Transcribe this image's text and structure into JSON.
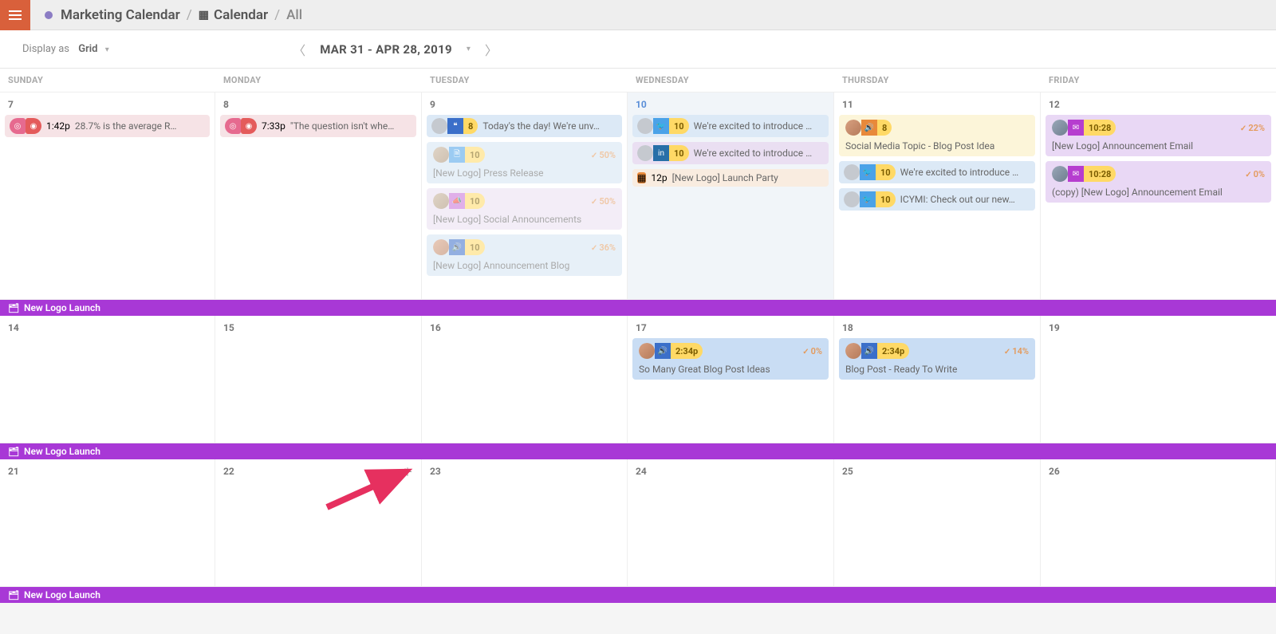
{
  "header": {
    "breadcrumb_root": "Marketing Calendar",
    "breadcrumb_view": "Calendar",
    "breadcrumb_filter": "All"
  },
  "toolbar": {
    "display_label": "Display as",
    "display_value": "Grid",
    "date_range": "MAR 31 - APR 28, 2019"
  },
  "day_headers": [
    "SUNDAY",
    "MONDAY",
    "TUESDAY",
    "WEDNESDAY",
    "THURSDAY",
    "FRIDAY"
  ],
  "campaign_label": "New Logo Launch",
  "weeks": [
    {
      "days": [
        {
          "num": "7",
          "events": [
            {
              "type": "strip",
              "bg": "bg-pink-l faded",
              "icons": [
                {
                  "cls": "ic-pink",
                  "glyph": "◎"
                },
                {
                  "cls": "ic-red",
                  "glyph": "◉"
                }
              ],
              "time": "1:42p",
              "text": "28.7% is the average R…"
            }
          ]
        },
        {
          "num": "8",
          "events": [
            {
              "type": "strip",
              "bg": "bg-pink-l faded",
              "icons": [
                {
                  "cls": "ic-pink",
                  "glyph": "◎"
                },
                {
                  "cls": "ic-red",
                  "glyph": "◉"
                }
              ],
              "time": "7:33p",
              "text": "\"The question isn't whe…"
            }
          ]
        },
        {
          "num": "9",
          "events": [
            {
              "type": "strip",
              "bg": "bg-blue-l faded",
              "avatar": "generic",
              "icons": [
                {
                  "cls": "ic-blue",
                  "glyph": "❝"
                }
              ],
              "badge": "8",
              "text": "Today's the day! We're unv…"
            },
            {
              "type": "card",
              "bg": "bg-blue-l2 faded",
              "avatar": "a1",
              "icons": [
                {
                  "cls": "ic-doc",
                  "glyph": "🗎"
                }
              ],
              "badge": "10",
              "progress": "50%",
              "title": "[New Logo] Press Release"
            },
            {
              "type": "card",
              "bg": "bg-purple-l faded",
              "avatar": "a1",
              "icons": [
                {
                  "cls": "ic-horn",
                  "glyph": "📣"
                }
              ],
              "badge": "10",
              "progress": "50%",
              "title": "[New Logo] Social Announcements"
            },
            {
              "type": "card",
              "bg": "bg-blue-l2 faded",
              "avatar": "a2",
              "icons": [
                {
                  "cls": "ic-rss",
                  "glyph": "🔊"
                }
              ],
              "badge": "10",
              "progress": "36%",
              "title": "[New Logo] Announcement Blog"
            }
          ]
        },
        {
          "num": "10",
          "today": true,
          "events": [
            {
              "type": "strip",
              "bg": "bg-blue-l",
              "avatar": "generic",
              "icons": [
                {
                  "cls": "ic-twitter",
                  "glyph": "🐦"
                }
              ],
              "badge": "10",
              "text": "We're excited to introduce …"
            },
            {
              "type": "strip",
              "bg": "bg-purple-l",
              "avatar": "generic",
              "icons": [
                {
                  "cls": "ic-linkedin",
                  "glyph": "in"
                }
              ],
              "badge": "10",
              "text": "We're excited to introduce …"
            },
            {
              "type": "strip",
              "bg": "bg-orange-l",
              "icons": [
                {
                  "cls": "ic-cal",
                  "glyph": "▦"
                }
              ],
              "time": "12p",
              "text": "[New Logo] Launch Party"
            }
          ]
        },
        {
          "num": "11",
          "events": [
            {
              "type": "card",
              "bg": "bg-yellow-l",
              "avatar": "a2",
              "icons": [
                {
                  "cls": "ic-rss-o",
                  "glyph": "🔊"
                }
              ],
              "badge": "8",
              "title": "Social Media Topic - Blog Post Idea"
            },
            {
              "type": "strip",
              "bg": "bg-blue-l",
              "avatar": "generic",
              "icons": [
                {
                  "cls": "ic-twitter",
                  "glyph": "🐦"
                }
              ],
              "badge": "10",
              "text": "We're excited to introduce …"
            },
            {
              "type": "strip",
              "bg": "bg-blue-l",
              "avatar": "generic",
              "icons": [
                {
                  "cls": "ic-twitter",
                  "glyph": "🐦"
                }
              ],
              "badge": "10",
              "text": "ICYMI: Check out our new…"
            }
          ]
        },
        {
          "num": "12",
          "events": [
            {
              "type": "card",
              "bg": "bg-purple2",
              "avatar": "a3",
              "icons": [
                {
                  "cls": "ic-mail",
                  "glyph": "✉"
                }
              ],
              "time": "10:28",
              "progress": "22%",
              "title": "[New Logo] Announcement Email"
            },
            {
              "type": "card",
              "bg": "bg-purple2",
              "avatar": "a3",
              "icons": [
                {
                  "cls": "ic-mail",
                  "glyph": "✉"
                }
              ],
              "time": "10:28",
              "progress": "0%",
              "title": "(copy) [New Logo] Announcement Email"
            }
          ]
        }
      ]
    },
    {
      "days": [
        {
          "num": "14",
          "events": []
        },
        {
          "num": "15",
          "events": []
        },
        {
          "num": "16",
          "events": []
        },
        {
          "num": "17",
          "events": [
            {
              "type": "card",
              "bg": "bg-blue-m",
              "avatar": "a2",
              "icons": [
                {
                  "cls": "ic-rss",
                  "glyph": "🔊"
                }
              ],
              "time": "2:34p",
              "progress": "0%",
              "title": "So Many Great Blog Post Ideas"
            }
          ]
        },
        {
          "num": "18",
          "events": [
            {
              "type": "card",
              "bg": "bg-blue-m",
              "avatar": "a2",
              "icons": [
                {
                  "cls": "ic-rss",
                  "glyph": "🔊"
                }
              ],
              "time": "2:34p",
              "progress": "14%",
              "title": "Blog Post - Ready To Write"
            }
          ]
        },
        {
          "num": "19",
          "events": []
        }
      ]
    },
    {
      "days": [
        {
          "num": "21",
          "events": []
        },
        {
          "num": "22",
          "hover": true,
          "events": []
        },
        {
          "num": "23",
          "events": []
        },
        {
          "num": "24",
          "events": []
        },
        {
          "num": "25",
          "events": []
        },
        {
          "num": "26",
          "events": []
        }
      ]
    }
  ]
}
